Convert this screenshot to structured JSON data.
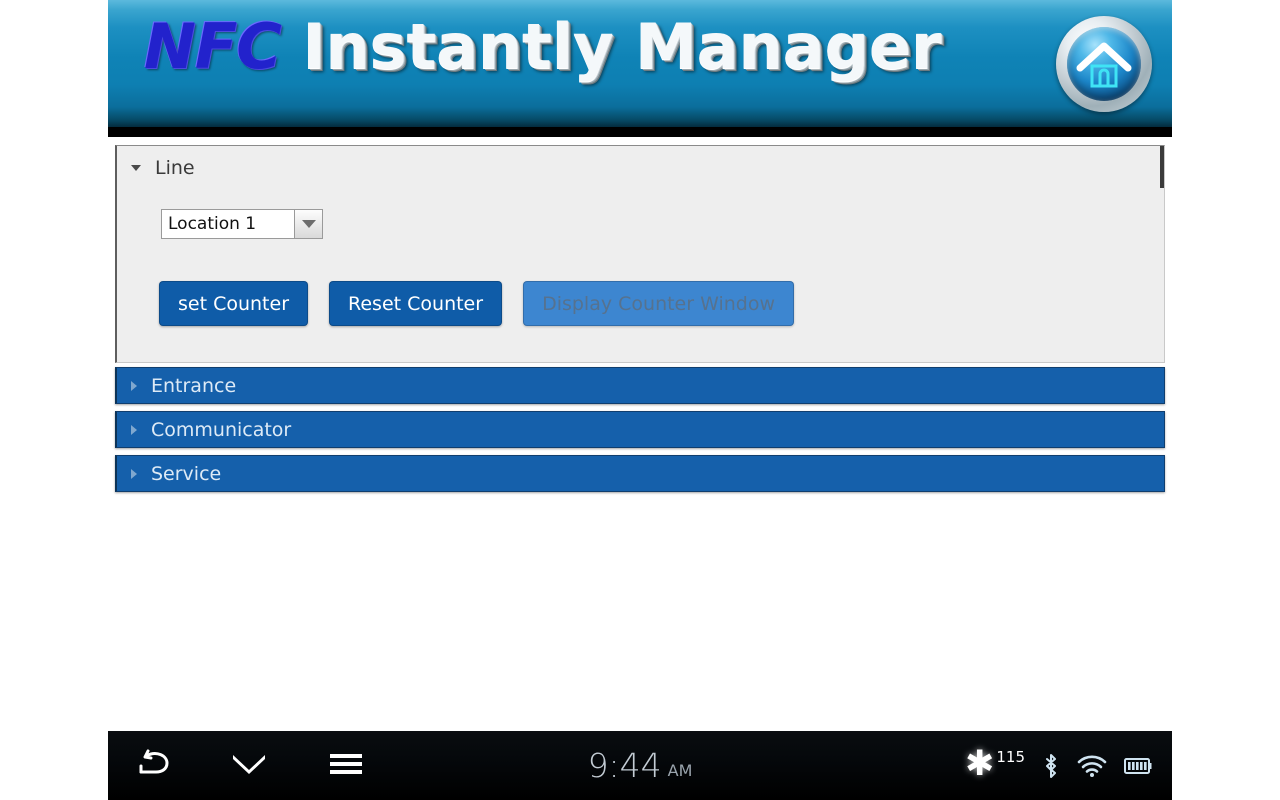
{
  "banner": {
    "title_accent": "NFC",
    "title_rest": " Instantly Manager",
    "home_icon": "home-badge-icon",
    "gradient_top": "#5cb9dd",
    "gradient_mid": "#0f83b6",
    "gradient_bottom": "#000000"
  },
  "line_panel": {
    "toggle_icon": "chevron-down-icon",
    "title": "Line",
    "select": {
      "value": "Location 1",
      "arrow_icon": "chevron-down-icon",
      "options": [
        "Location 1"
      ]
    },
    "buttons": [
      {
        "label": "set Counter",
        "state": "enabled",
        "color": "#0f5ca8"
      },
      {
        "label": "Reset Counter",
        "state": "enabled",
        "color": "#0f5ca8"
      },
      {
        "label": "Display Counter Window",
        "state": "disabled",
        "color": "#3d86d0"
      }
    ]
  },
  "sections": [
    {
      "label": "Entrance",
      "expanded": false,
      "toggle_icon": "chevron-right-icon"
    },
    {
      "label": "Communicator",
      "expanded": false,
      "toggle_icon": "chevron-right-icon"
    },
    {
      "label": "Service",
      "expanded": false,
      "toggle_icon": "chevron-right-icon"
    }
  ],
  "navbar": {
    "back_icon": "back-arrow-icon",
    "hide_keyboard_icon": "chevron-down-double-icon",
    "menu_icon": "hamburger-menu-icon",
    "clock_time": "9:44",
    "clock_ampm": "AM",
    "notification_icon": "asterisk-icon",
    "notification_count": "115",
    "bluetooth_icon": "bluetooth-icon",
    "wifi_icon": "wifi-icon",
    "battery_icon": "battery-full-icon",
    "background": "#000000"
  }
}
